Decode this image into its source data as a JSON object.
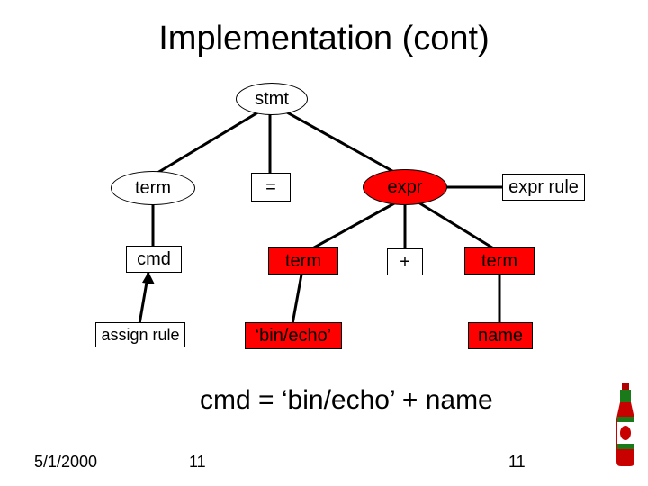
{
  "title": "Implementation (cont)",
  "nodes": {
    "stmt": "stmt",
    "term_left": "term",
    "equals": "=",
    "expr": "expr",
    "expr_rule": "expr rule",
    "cmd": "cmd",
    "term_mid": "term",
    "plus": "+",
    "term_right": "term",
    "assign_rule": "assign rule",
    "bin_echo": "‘bin/echo’",
    "name": "name"
  },
  "summary": "cmd = ‘bin/echo’ + name",
  "footer": {
    "date": "5/1/2000",
    "page_left": "11",
    "page_right": "11"
  },
  "chart_data": {
    "type": "tree",
    "title": "Implementation (cont)",
    "nodes": [
      {
        "id": "stmt",
        "label": "stmt",
        "shape": "ellipse"
      },
      {
        "id": "term_left",
        "label": "term",
        "shape": "ellipse"
      },
      {
        "id": "equals",
        "label": "=",
        "shape": "rect"
      },
      {
        "id": "expr",
        "label": "expr",
        "shape": "ellipse",
        "fill": "red"
      },
      {
        "id": "expr_rule",
        "label": "expr rule",
        "shape": "rect"
      },
      {
        "id": "cmd",
        "label": "cmd",
        "shape": "rect"
      },
      {
        "id": "term_mid",
        "label": "term",
        "shape": "rect",
        "fill": "red"
      },
      {
        "id": "plus",
        "label": "+",
        "shape": "rect"
      },
      {
        "id": "term_right",
        "label": "term",
        "shape": "rect",
        "fill": "red"
      },
      {
        "id": "assign_rule",
        "label": "assign rule",
        "shape": "rect"
      },
      {
        "id": "bin_echo",
        "label": "‘bin/echo’",
        "shape": "rect",
        "fill": "red"
      },
      {
        "id": "name",
        "label": "name",
        "shape": "rect",
        "fill": "red"
      }
    ],
    "edges": [
      {
        "from": "stmt",
        "to": "term_left"
      },
      {
        "from": "stmt",
        "to": "equals"
      },
      {
        "from": "stmt",
        "to": "expr"
      },
      {
        "from": "term_left",
        "to": "cmd"
      },
      {
        "from": "expr",
        "to": "expr_rule"
      },
      {
        "from": "expr",
        "to": "term_mid"
      },
      {
        "from": "expr",
        "to": "plus"
      },
      {
        "from": "expr",
        "to": "term_right"
      },
      {
        "from": "cmd",
        "to": "assign_rule"
      },
      {
        "from": "term_mid",
        "to": "bin_echo"
      },
      {
        "from": "term_right",
        "to": "name"
      }
    ],
    "summary_expression": "cmd = ‘bin/echo’ + name"
  }
}
